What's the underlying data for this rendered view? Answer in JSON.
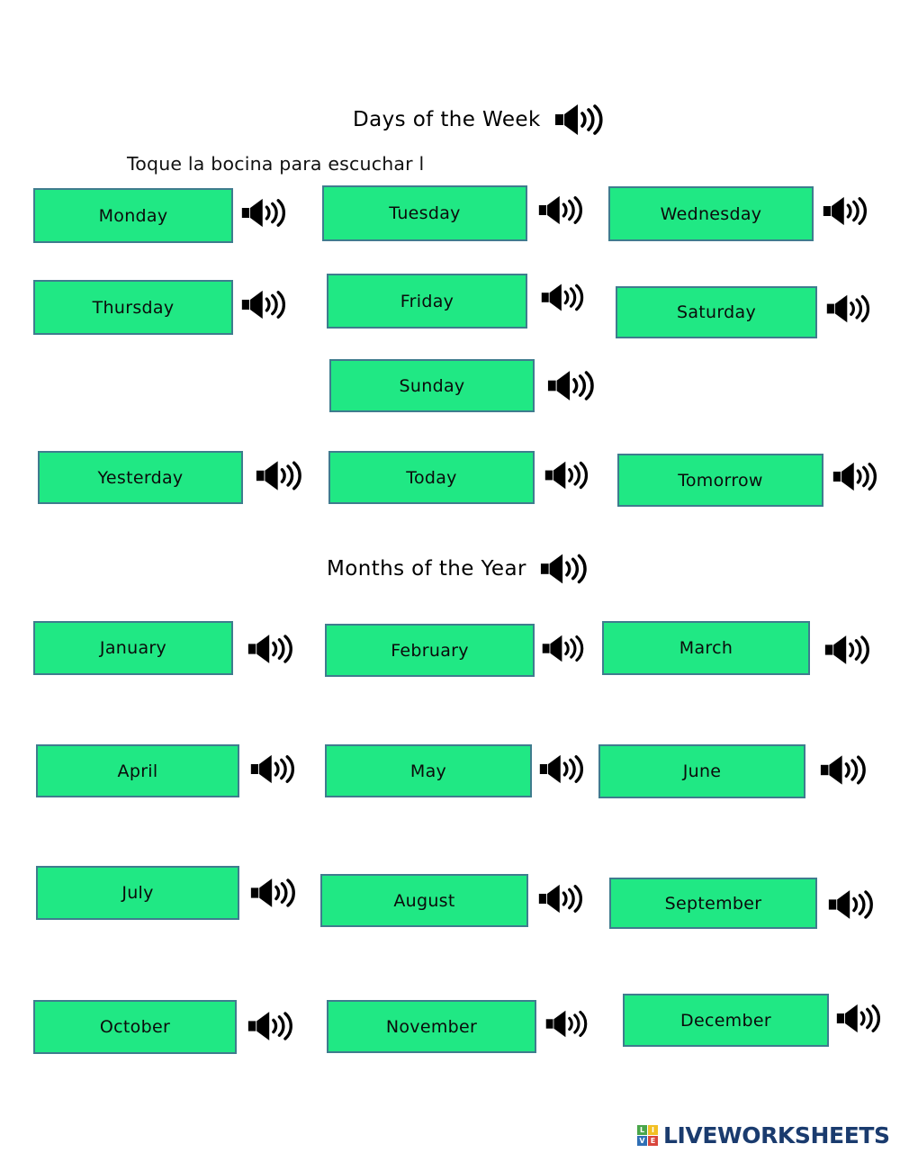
{
  "worksheet": {
    "sections": [
      {
        "id": "days",
        "title": "Days of the Week",
        "title_icon": "speaker-icon",
        "subtitle": "Toque la bocina para escuchar l"
      },
      {
        "id": "months",
        "title": "Months of the Year",
        "title_icon": "speaker-icon",
        "subtitle": ""
      }
    ],
    "days": [
      {
        "label": "Monday",
        "icon": "speaker-icon"
      },
      {
        "label": "Tuesday",
        "icon": "speaker-icon"
      },
      {
        "label": "Wednesday",
        "icon": "speaker-icon"
      },
      {
        "label": "Thursday",
        "icon": "speaker-icon"
      },
      {
        "label": "Friday",
        "icon": "speaker-icon"
      },
      {
        "label": "Saturday",
        "icon": "speaker-icon"
      },
      {
        "label": "Sunday",
        "icon": "speaker-icon"
      }
    ],
    "relative_days": [
      {
        "label": "Yesterday",
        "icon": "speaker-icon"
      },
      {
        "label": "Today",
        "icon": "speaker-icon"
      },
      {
        "label": "Tomorrow",
        "icon": "speaker-icon"
      }
    ],
    "months": [
      {
        "label": "January",
        "icon": "speaker-icon"
      },
      {
        "label": "February",
        "icon": "speaker-icon"
      },
      {
        "label": "March",
        "icon": "speaker-icon"
      },
      {
        "label": "April",
        "icon": "speaker-icon"
      },
      {
        "label": "May",
        "icon": "speaker-icon"
      },
      {
        "label": "June",
        "icon": "speaker-icon"
      },
      {
        "label": "July",
        "icon": "speaker-icon"
      },
      {
        "label": "August",
        "icon": "speaker-icon"
      },
      {
        "label": "September",
        "icon": "speaker-icon"
      },
      {
        "label": "October",
        "icon": "speaker-icon"
      },
      {
        "label": "November",
        "icon": "speaker-icon"
      },
      {
        "label": "December",
        "icon": "speaker-icon"
      }
    ],
    "footer": {
      "brand_tiles": [
        "L",
        "I",
        "V",
        "E"
      ],
      "brand_word": "LIVEWORKSHEETS"
    },
    "colors": {
      "chip_fill": "#20E884",
      "chip_border": "#3f7c8e",
      "icon": "#000000",
      "brand_navy": "#1a3b6e",
      "tile_green": "#4aa64a",
      "tile_yellow": "#f2c024",
      "tile_blue": "#2f6fb5",
      "tile_red": "#d9453c"
    }
  }
}
